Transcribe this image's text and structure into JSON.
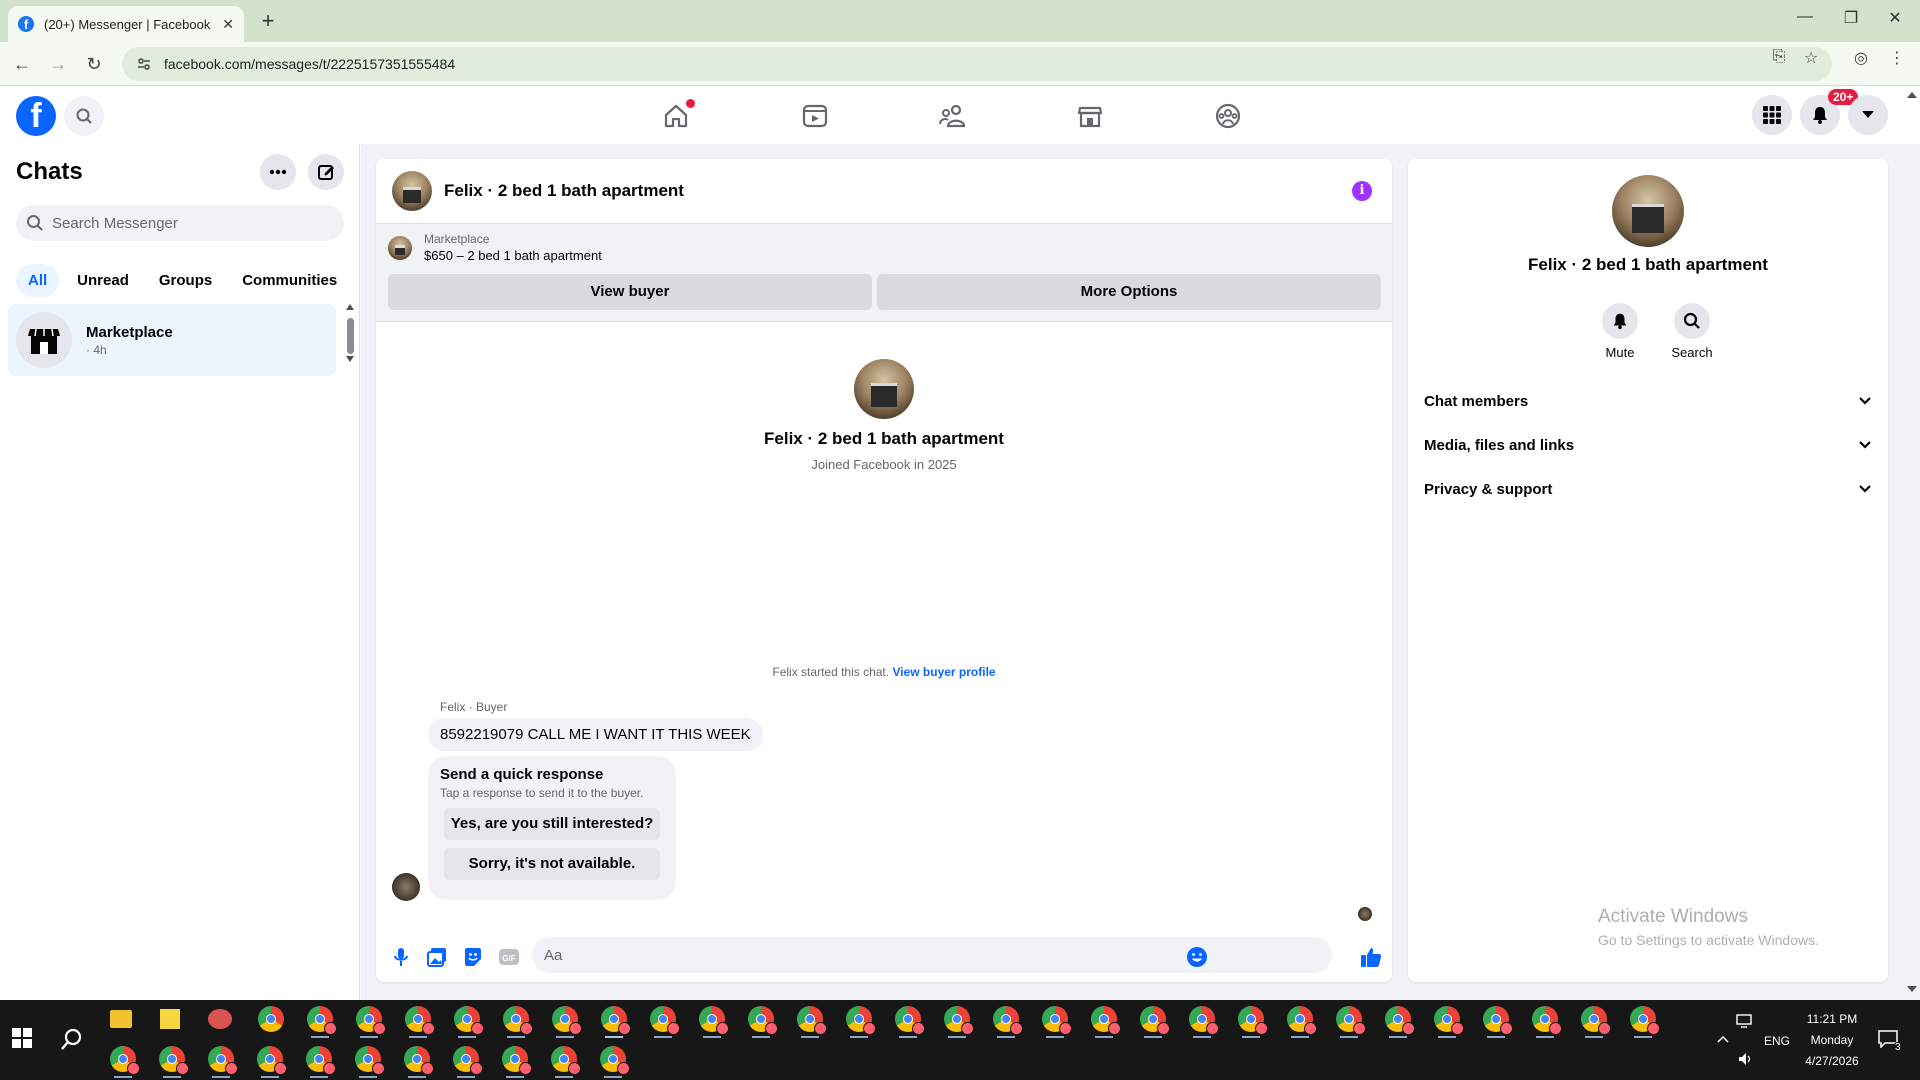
{
  "browser": {
    "tab_title": "(20+) Messenger | Facebook",
    "url": "facebook.com/messages/t/2225157351555484",
    "new_tab_icon": "plus-icon",
    "accent": "#d3e3cb"
  },
  "fb_nav": {
    "logo": "f",
    "notification_badge": "20+",
    "brand_color": "#0866ff",
    "icons": [
      "home-icon",
      "video-icon",
      "friends-icon",
      "marketplace-icon",
      "groups-icon",
      "apps-grid-icon",
      "bell-icon",
      "account-caret-icon"
    ]
  },
  "chats": {
    "title": "Chats",
    "search_placeholder": "Search Messenger",
    "filters": [
      "All",
      "Unread",
      "Groups",
      "Communities"
    ],
    "items": [
      {
        "name": "Marketplace",
        "time": "· 4h"
      }
    ]
  },
  "conversation": {
    "title": "Felix · 2 bed 1 bath apartment",
    "marketplace_label": "Marketplace",
    "listing": "$650 – 2 bed 1 bath apartment",
    "view_buyer": "View buyer",
    "more_options": "More Options",
    "profile_name": "Felix · 2 bed 1 bath apartment",
    "joined": "Joined Facebook in 2025",
    "started_note": "Felix started this chat.",
    "view_profile_link": "View buyer profile",
    "sender_label": "Felix · Buyer",
    "message": "8592219079 CALL ME I WANT IT THIS WEEK",
    "quick_title": "Send a quick response",
    "quick_subtitle": "Tap a response to send it to the buyer.",
    "quick_options": [
      "Yes, are you still interested?",
      "Sorry, it's not available."
    ],
    "composer_placeholder": "Aa",
    "accent": "#a033ff"
  },
  "details": {
    "name": "Felix · 2 bed 1 bath apartment",
    "actions": [
      {
        "label": "Mute",
        "icon": "bell-icon"
      },
      {
        "label": "Search",
        "icon": "search-icon"
      }
    ],
    "sections": [
      "Chat members",
      "Media, files and links",
      "Privacy & support"
    ]
  },
  "watermark": {
    "line1": "Activate Windows",
    "line2": "Go to Settings to activate Windows."
  },
  "taskbar": {
    "time": "11:21 PM",
    "day": "Monday",
    "date": "4/27/2026",
    "lang": "ENG",
    "notifications": "3"
  }
}
